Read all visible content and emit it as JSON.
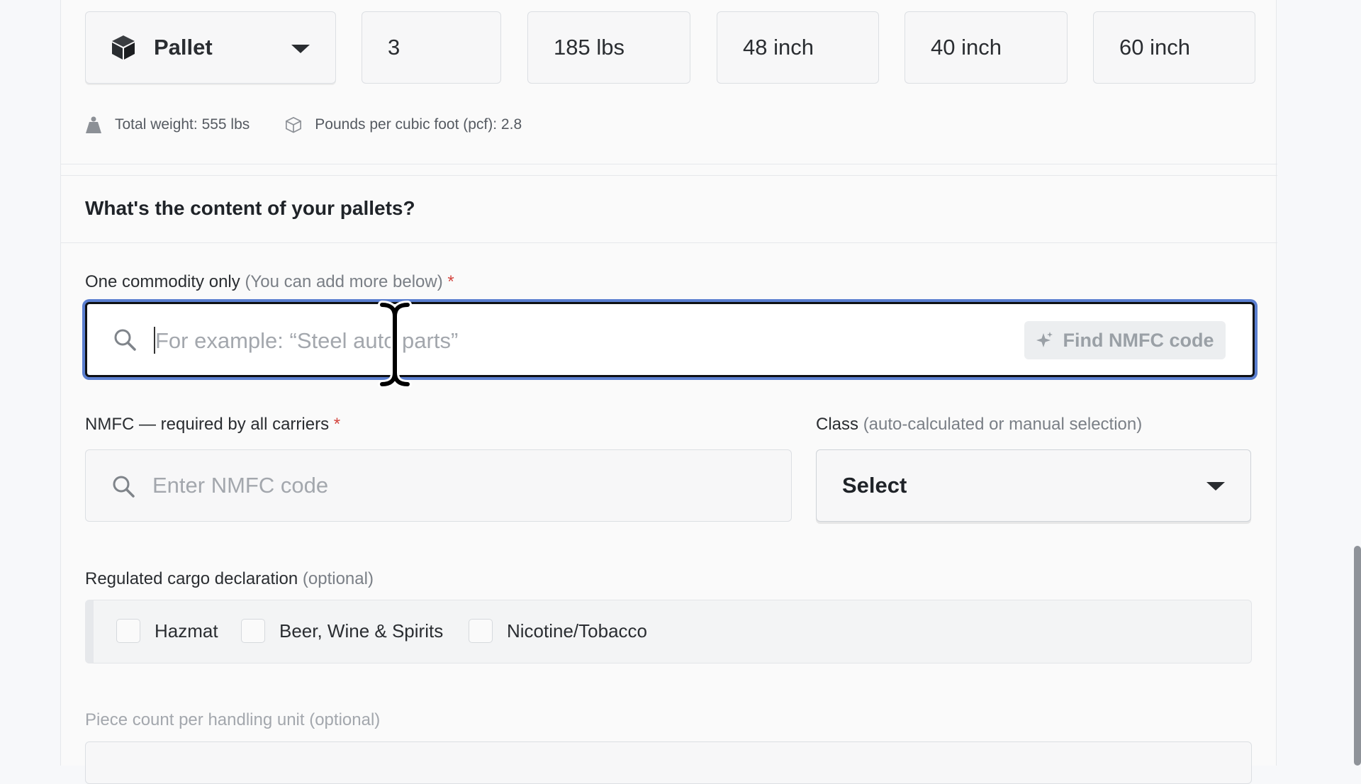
{
  "handling_unit": {
    "type_label": "Pallet",
    "quantity": "3",
    "weight": "185 lbs",
    "length": "48 inch",
    "width": "40 inch",
    "height": "60 inch"
  },
  "summary": {
    "total_weight": "Total weight: 555 lbs",
    "pcf": "Pounds per cubic foot (pcf): 2.8"
  },
  "content_section": {
    "title": "What's the content of your pallets?"
  },
  "commodity": {
    "label": "One commodity only",
    "hint": "(You can add more below)",
    "required_mark": "*",
    "placeholder": "For example: “Steel auto parts”",
    "find_button": "Find NMFC code"
  },
  "nmfc": {
    "label": "NMFC — required by all carriers",
    "required_mark": "*",
    "placeholder": "Enter NMFC code"
  },
  "class": {
    "label": "Class",
    "hint": "(auto-calculated or manual selection)",
    "selected": "Select"
  },
  "regulated": {
    "label": "Regulated cargo declaration",
    "hint": "(optional)",
    "options": [
      "Hazmat",
      "Beer, Wine & Spirits",
      "Nicotine/Tobacco"
    ]
  },
  "piece_count": {
    "label": "Piece count per handling unit (optional)"
  }
}
